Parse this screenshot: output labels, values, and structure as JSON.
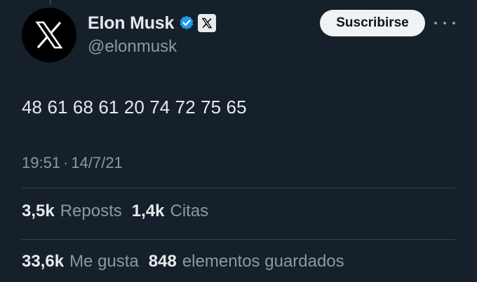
{
  "author": {
    "display_name": "Elon Musk",
    "handle": "@elonmusk",
    "verified": true,
    "verified_color": "#1d9bf0",
    "avatar_icon": "x-logo-icon",
    "affiliate_icon": "x-logo-icon"
  },
  "actions": {
    "subscribe_label": "Suscribirse",
    "more_icon": "more-horizontal-icon"
  },
  "tweet": {
    "text": "48 61 68 61 20 74 72 75 65",
    "time": "19:51",
    "separator": "·",
    "date": "14/7/21"
  },
  "stats": {
    "reposts": {
      "count": "3,5k",
      "label": "Reposts"
    },
    "quotes": {
      "count": "1,4k",
      "label": "Citas"
    },
    "likes": {
      "count": "33,6k",
      "label": "Me gusta"
    },
    "bookmarks": {
      "count": "848",
      "label": "elementos guardados"
    }
  },
  "colors": {
    "background": "#15202b",
    "text_primary": "#e7e9ea",
    "text_secondary": "#8b98a5",
    "divider": "#38444d"
  }
}
